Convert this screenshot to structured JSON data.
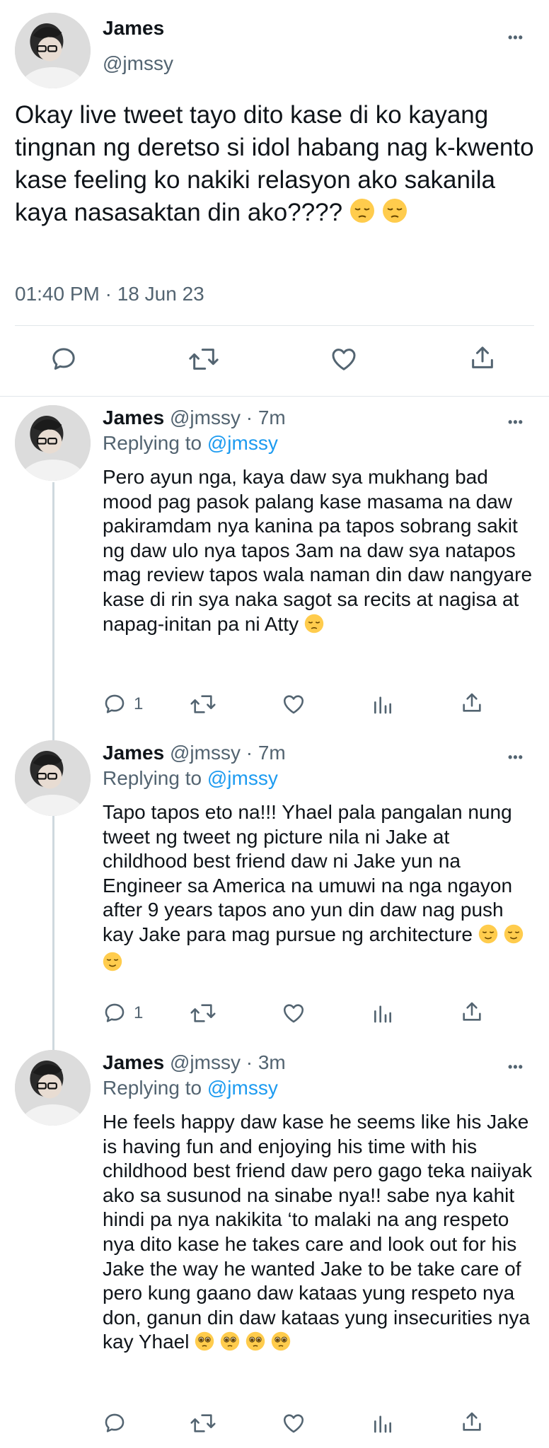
{
  "main_tweet": {
    "author_name": "James",
    "author_handle": "@jmssy",
    "text": "Okay live tweet tayo dito kase di ko kayang tingnan ng deretso si idol habang nag k-kwento kase feeling ko nakiki relasyon ako sakanila kaya nasasaktan din ako????",
    "emojis": [
      "pensive-face",
      "pensive-face"
    ],
    "timestamp": "01:40 PM · 18 Jun 23",
    "more_label": "•••",
    "actions": [
      "reply-icon",
      "retweet-icon",
      "like-icon",
      "share-icon"
    ]
  },
  "replies": [
    {
      "author_name": "James",
      "meta": "@jmssy · 7m",
      "replying_prefix": "Replying to",
      "replying_mention": "@jmssy",
      "text": "Pero ayun nga, kaya daw sya mukhang bad mood pag pasok palang kase masama na daw pakiramdam nya kanina pa tapos sobrang sakit ng daw ulo nya tapos 3am na daw sya natapos mag review tapos wala naman din daw nangyare kase di rin sya naka sagot sa recits at nagisa at napag-initan pa ni Atty",
      "emojis": [
        "pensive-face"
      ],
      "reply_count": "1",
      "more_label": "•••"
    },
    {
      "author_name": "James",
      "meta": "@jmssy · 7m",
      "replying_prefix": "Replying to",
      "replying_mention": "@jmssy",
      "text": "Tapo tapos eto na!!! Yhael pala pangalan nung tweet ng tweet ng picture nila ni Jake at childhood best friend daw ni Jake yun na Engineer sa America na umuwi na nga ngayon after 9 years tapos ano yun din daw nag push kay Jake para mag pursue ng architecture",
      "emojis": [
        "relieved-face",
        "relieved-face",
        "relieved-face"
      ],
      "reply_count": "1",
      "more_label": "•••"
    },
    {
      "author_name": "James",
      "meta": "@jmssy · 3m",
      "replying_prefix": "Replying to",
      "replying_mention": "@jmssy",
      "text": "He feels happy daw kase he seems like his Jake is having fun and enjoying his time with his childhood best friend daw pero gago teka naiiyak ako sa susunod na sinabe nya!! sabe nya kahit hindi pa nya nakikita ‘to malaki na ang respeto nya dito kase he takes care and look out for his Jake the way he wanted Jake to be take care of pero kung gaano daw kataas yung respeto nya don, ganun din daw kataas yung insecurities nya kay Yhael",
      "emojis": [
        "pleading-face",
        "pleading-face",
        "pleading-face",
        "pleading-face"
      ],
      "reply_count": "",
      "more_label": "•••"
    }
  ],
  "colors": {
    "text": "#0f1419",
    "secondary": "#536471",
    "mention": "#1d9bf0",
    "divider": "#e1e6ea",
    "emoji_face": "#ffcc4d"
  }
}
